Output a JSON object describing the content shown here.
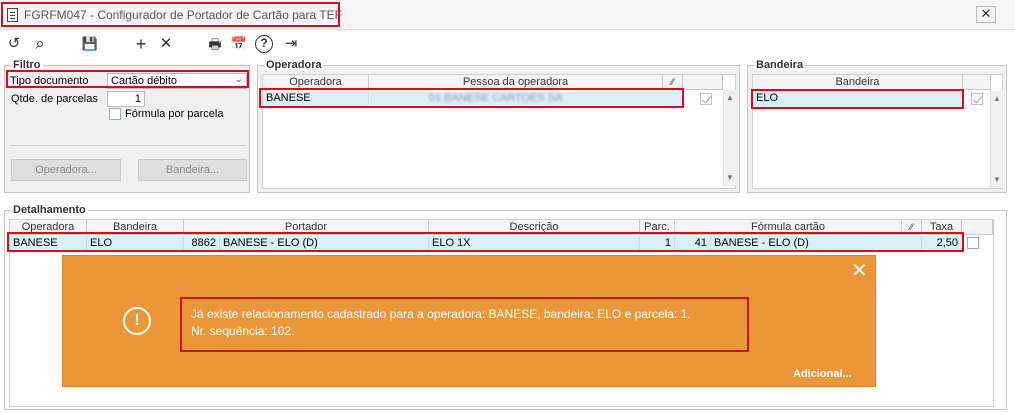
{
  "window": {
    "title": "FGRFM047 - Configurador de Portador de Cartão para TEF",
    "close": "✕"
  },
  "toolbar": {
    "undo": "↺",
    "search": "⌕",
    "save": "💾",
    "add": "+",
    "remove": "✕",
    "print": "🖶",
    "calendar": "📅",
    "help": "?",
    "exit": "⇥"
  },
  "filtro": {
    "title": "Filtro",
    "tipo_label": "Tipo documento",
    "tipo_value": "Cartão débito",
    "parcelas_label": "Qtde. de parcelas",
    "parcelas_value": "1",
    "formula_label": "Fórmula por parcela",
    "operadora_btn": "Operadora...",
    "bandeira_btn": "Bandeira..."
  },
  "operadora": {
    "title": "Operadora",
    "col_operadora": "Operadora",
    "col_pessoa": "Pessoa da operadora",
    "rows": [
      {
        "operadora": "BANESE",
        "pessoa": "01 BANESE CARTOES SA"
      }
    ]
  },
  "bandeira": {
    "title": "Bandeira",
    "col_bandeira": "Bandeira",
    "rows": [
      {
        "bandeira": "ELO"
      }
    ]
  },
  "detalhamento": {
    "title": "Detalhamento",
    "columns": [
      "Operadora",
      "Bandeira",
      "Portador",
      "Descrição",
      "Parc.",
      "Fórmula cartão",
      "Taxa"
    ],
    "rows": [
      {
        "operadora": "BANESE",
        "bandeira": "ELO",
        "portador_cod": "8862",
        "portador": "BANESE - ELO (D)",
        "descricao": "ELO 1X",
        "parc": "1",
        "formula_cod": "41",
        "formula": "BANESE - ELO (D)",
        "taxa": "2,50"
      }
    ]
  },
  "toast": {
    "icon": "!",
    "line1": "Já existe relacionamento cadastrado para a operadora: BANESE, bandeira: ELO e parcela: 1.",
    "line2": "Nr. sequência: 102.",
    "more": "Adicional...",
    "close": "✕",
    "color": "#eb9739"
  }
}
